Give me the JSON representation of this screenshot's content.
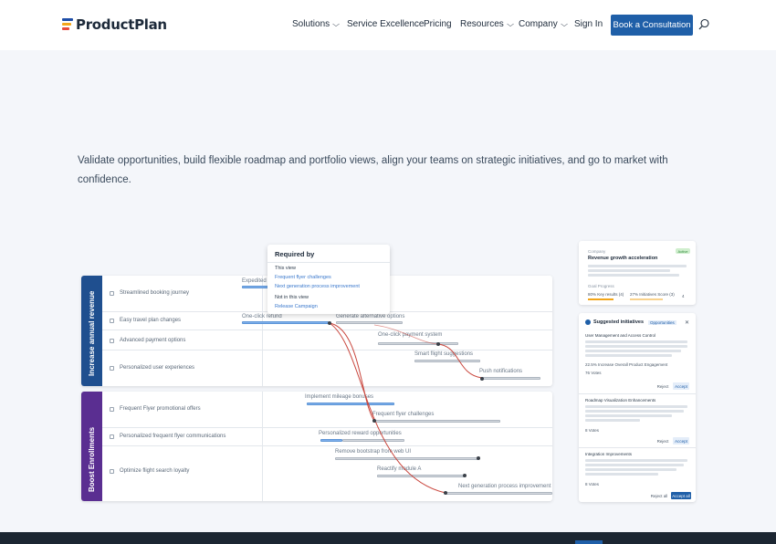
{
  "header": {
    "brand": "ProductPlan",
    "nav": [
      {
        "label": "Solutions",
        "has_dropdown": true
      },
      {
        "label": "Service Excellence",
        "has_dropdown": false
      },
      {
        "label": "Pricing",
        "has_dropdown": false
      },
      {
        "label": "Resources",
        "has_dropdown": true
      },
      {
        "label": "Company",
        "has_dropdown": true
      },
      {
        "label": "Sign In",
        "has_dropdown": false
      }
    ],
    "cta_label": "Book a Consultation",
    "search_icon": "search-icon"
  },
  "intro_text": "Validate opportunities, build flexible roadmap and portfolio views, align your teams on strategic initiatives, and go to market with confidence.",
  "roadmap": {
    "lanes": [
      {
        "title": "Increase annual revenue",
        "color": "#1f4f8f",
        "rows": [
          "Streamlined booking journey",
          "Easy travel plan changes",
          "Advanced payment options",
          "Personalized user experiences"
        ]
      },
      {
        "title": "Boost Enrollments",
        "color": "#5a2e91",
        "rows": [
          "Frequent Flyer promotional offers",
          "Personalized frequent flyer communications",
          "Optimize flight search loyalty"
        ]
      }
    ],
    "bars": {
      "expedited": "Expedited",
      "one_click_refund": "One-click refund",
      "generate_alt": "Generate alternative options",
      "one_click_payment": "One-click payment system",
      "smart_flight": "Smart flight suggestions",
      "push_notifications": "Push notifications",
      "mileage_bonuses": "Implement mileage bonuses",
      "frequent_flyer": "Frequent flyer challenges",
      "personalized_reward": "Personalized reward opportunities",
      "remove_bootstrap": "Remove bootstrap from web UI",
      "reactify": "Reactify module A",
      "next_gen": "Next generation process improvement"
    }
  },
  "popover": {
    "title": "Required by",
    "this_view_label": "This view",
    "this_view_items": [
      "Frequent flyer challenges",
      "Next generation process improvement"
    ],
    "not_in_view_label": "Not in this view",
    "not_in_view_items": [
      "Release Campaign"
    ]
  },
  "card_objective": {
    "kicker": "Company",
    "title": "Revenue growth acceleration",
    "badge": "Active",
    "footer_label": "Goal Progress",
    "stat1": "80% Key results (4)",
    "stat2": "27% Initiatives Score (3)",
    "count": "4"
  },
  "card_suggested": {
    "title": "Suggested initiatives",
    "tag": "Opportunities",
    "close_icon": "close-icon",
    "items": [
      {
        "title": "User Management and Access Control",
        "meta": "22.5% Increase Overall Product Engagement",
        "votes": "76 Votes",
        "reject": "Reject",
        "accept": "Accept"
      },
      {
        "title": "Roadmap Visualization Enhancements",
        "votes": "8 Votes",
        "reject": "Reject",
        "accept": "Accept"
      },
      {
        "title": "Integration Improvements",
        "votes": "8 Votes"
      }
    ],
    "footer_reject": "Reject all",
    "footer_accept": "Accept all"
  },
  "colors": {
    "brand_blue": "#1f5fa8",
    "lane_revenue": "#1f4f8f",
    "lane_enrollments": "#5a2e91",
    "connector_red": "#c9463d"
  }
}
